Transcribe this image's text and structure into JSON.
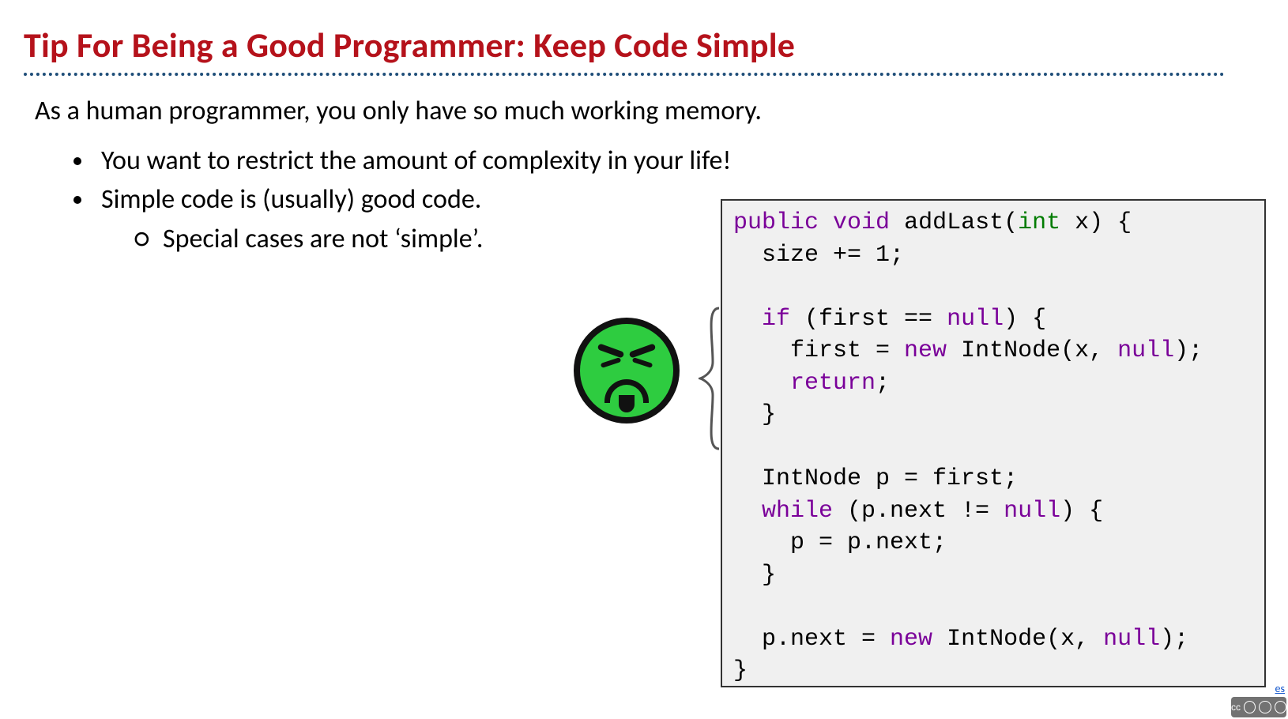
{
  "title": "Tip For Being a Good Programmer: Keep Code Simple",
  "lead": "As a human programmer, you only have so much working memory.",
  "bullets": {
    "b1": "You want to restrict the amount of complexity in your life!",
    "b2": "Simple code is (usually) good code.",
    "b2_sub1": "Special cases are not ‘simple’."
  },
  "code": {
    "l1_kw1": "public",
    "l1_kw2": "void",
    "l1_rest": " addLast(",
    "l1_ty": "int",
    "l1_rest2": " x) {",
    "l2": "  size += 1;",
    "l3": "",
    "l4a": "  ",
    "l4_kw": "if",
    "l4b": " (first == ",
    "l4_kw2": "null",
    "l4c": ") {",
    "l5a": "    first = ",
    "l5_kw": "new",
    "l5b": " IntNode(x, ",
    "l5_kw2": "null",
    "l5c": ");",
    "l6a": "    ",
    "l6_kw": "return",
    "l6b": ";",
    "l7": "  }",
    "l8": "",
    "l9": "  IntNode p = first;",
    "l10a": "  ",
    "l10_kw": "while",
    "l10b": " (p.next != ",
    "l10_kw2": "null",
    "l10c": ") {",
    "l11": "    p = p.next;",
    "l12": "  }",
    "l13": "",
    "l14a": "  p.next = ",
    "l14_kw": "new",
    "l14b": " IntNode(x, ",
    "l14_kw2": "null",
    "l14c": ");",
    "l15": "}"
  },
  "footer": {
    "es": "es",
    "cc": "cc"
  }
}
